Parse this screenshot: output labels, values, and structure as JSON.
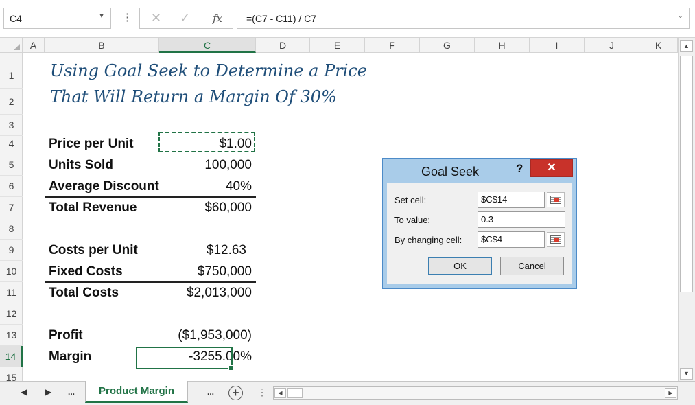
{
  "formula_bar": {
    "name_box": "C4",
    "name_box_arrow": "▼",
    "dots": "⋮",
    "cancel_glyph": "✕",
    "enter_glyph": "✓",
    "fx_glyph": "fx",
    "formula": "=(C7 - C11) / C7",
    "expand_arrow": "⌄"
  },
  "columns": [
    "A",
    "B",
    "C",
    "D",
    "E",
    "F",
    "G",
    "H",
    "I",
    "J",
    "K"
  ],
  "selected_column": "C",
  "rows": [
    "1",
    "2",
    "3",
    "4",
    "5",
    "6",
    "7",
    "8",
    "9",
    "10",
    "11",
    "12",
    "13",
    "14",
    "15"
  ],
  "selected_row": "14",
  "sheet": {
    "title_line1": "Using Goal Seek to Determine a Price",
    "title_line2": "That Will Return a Margin Of 30%",
    "price_label": "Price per Unit",
    "price_value": "$1.00",
    "units_label": "Units Sold",
    "units_value": "100,000",
    "discount_label": "Average Discount",
    "discount_value": "40%",
    "revenue_label": "Total Revenue",
    "revenue_value": "$60,000",
    "cpu_label": "Costs per Unit",
    "cpu_value": "$12.63",
    "fixed_label": "Fixed Costs",
    "fixed_value": "$750,000",
    "total_costs_label": "Total Costs",
    "total_costs_value": "$2,013,000",
    "profit_label": "Profit",
    "profit_value": "($1,953,000)",
    "margin_label": "Margin",
    "margin_value": "-3255.00%"
  },
  "tabs": {
    "prev": "◀",
    "next": "▶",
    "more_left": "...",
    "sheet_name": "Product Margin",
    "more_right": "...",
    "add": "+",
    "divider": "⋮",
    "scroll_left": "◀",
    "scroll_right": "▶"
  },
  "vscroll": {
    "up": "▲",
    "down": "▼"
  },
  "dialog": {
    "title": "Goal Seek",
    "help": "?",
    "close": "✕",
    "set_cell_label": "Set cell:",
    "set_cell_value": "$C$14",
    "to_value_label": "To value:",
    "to_value_value": "0.3",
    "changing_label": "By changing cell:",
    "changing_value": "$C$4",
    "ok": "OK",
    "cancel": "Cancel"
  },
  "colors": {
    "excel_green": "#217346",
    "title_blue": "#1f4e79",
    "dialog_frame": "#a9cce9",
    "close_red": "#c8322a"
  }
}
